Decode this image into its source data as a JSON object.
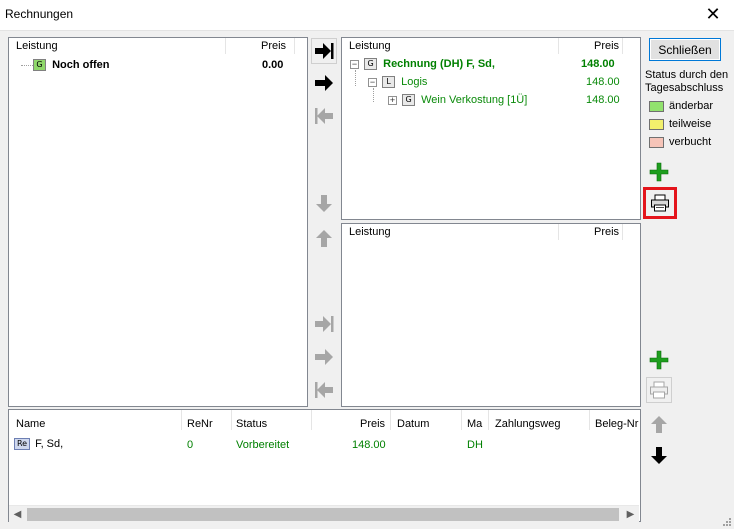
{
  "window": {
    "title": "Rechnungen",
    "close_glyph": "✕"
  },
  "left_panel": {
    "col_leistung": "Leistung",
    "col_preis": "Preis",
    "row": {
      "icon": "G",
      "label": "Noch offen",
      "price": "0.00"
    }
  },
  "right_top_panel": {
    "col_leistung": "Leistung",
    "col_preis": "Preis",
    "rows": [
      {
        "expander": "−",
        "icon": "G",
        "label": "Rechnung (DH) F, Sd,",
        "price": "148.00"
      },
      {
        "expander": "−",
        "icon": "L",
        "label": "Logis",
        "price": "148.00"
      },
      {
        "expander": "+",
        "icon": "G",
        "label": "Wein Verkostung [1Ü]",
        "price": "148.00"
      }
    ]
  },
  "right_bottom_panel": {
    "col_leistung": "Leistung",
    "col_preis": "Preis"
  },
  "invoice_list": {
    "columns": {
      "name": "Name",
      "renr": "ReNr",
      "status": "Status",
      "preis": "Preis",
      "datum": "Datum",
      "ma": "Ma",
      "zahlungsweg": "Zahlungsweg",
      "beleg": "Beleg-Nr"
    },
    "rows": [
      {
        "icon": "Re",
        "name": "F, Sd,",
        "renr": "0",
        "status": "Vorbereitet",
        "preis": "148.00",
        "datum": "",
        "ma": "DH",
        "zahlungsweg": "",
        "beleg": ""
      }
    ]
  },
  "sidebar": {
    "close_button": "Schließen",
    "status_title_line1": "Status durch den",
    "status_title_line2": "Tagesabschluss",
    "legend": [
      {
        "label": "änderbar",
        "color": "#92e26e"
      },
      {
        "label": "teilweise",
        "color": "#f2f06c"
      },
      {
        "label": "verbucht",
        "color": "#f6c4b8"
      }
    ]
  },
  "colors": {
    "status_green": "#008000",
    "highlight_red": "#e4141b",
    "accent_blue": "#0078d7"
  }
}
